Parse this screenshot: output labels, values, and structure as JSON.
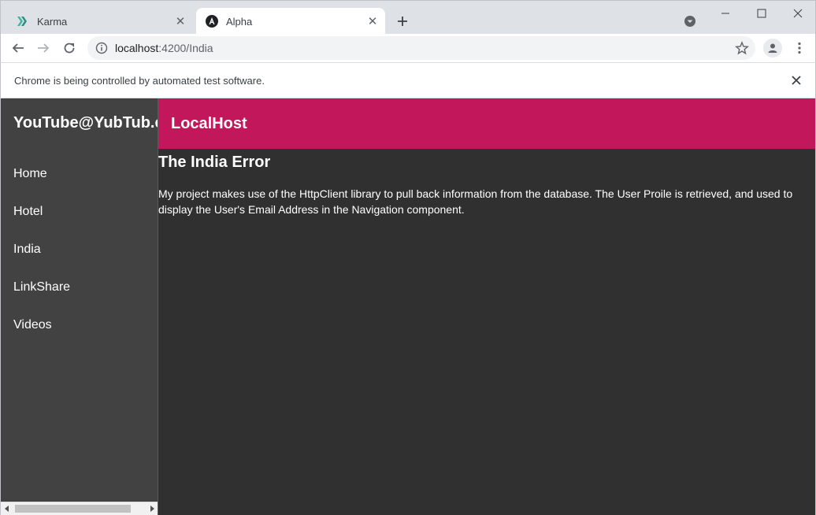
{
  "browser": {
    "tabs": [
      {
        "title": "Karma",
        "active": false
      },
      {
        "title": "Alpha",
        "active": true
      }
    ],
    "address": {
      "host": "localhost",
      "path": ":4200/India"
    },
    "infobar_message": "Chrome is being controlled by automated test software.",
    "icons": {
      "back": "back-arrow-icon",
      "forward": "forward-arrow-icon",
      "reload": "reload-icon",
      "info": "info-icon",
      "star": "star-icon",
      "profile": "profile-icon",
      "menu": "menu-dots-icon"
    }
  },
  "app": {
    "brand": "YouTube@YubTub.cl",
    "nav": [
      {
        "label": "Home"
      },
      {
        "label": "Hotel"
      },
      {
        "label": "India"
      },
      {
        "label": "LinkShare"
      },
      {
        "label": "Videos"
      }
    ],
    "toolbar_title": "LocalHost",
    "toolbar_color": "#c2185b",
    "sidebar_color": "#424242",
    "background_color": "#303030"
  },
  "page": {
    "heading": "The India Error",
    "body": "My project makes use of the HttpClient library to pull back information from the database. The User Proile is retrieved, and used to display the User's Email Address in the Navigation component."
  }
}
